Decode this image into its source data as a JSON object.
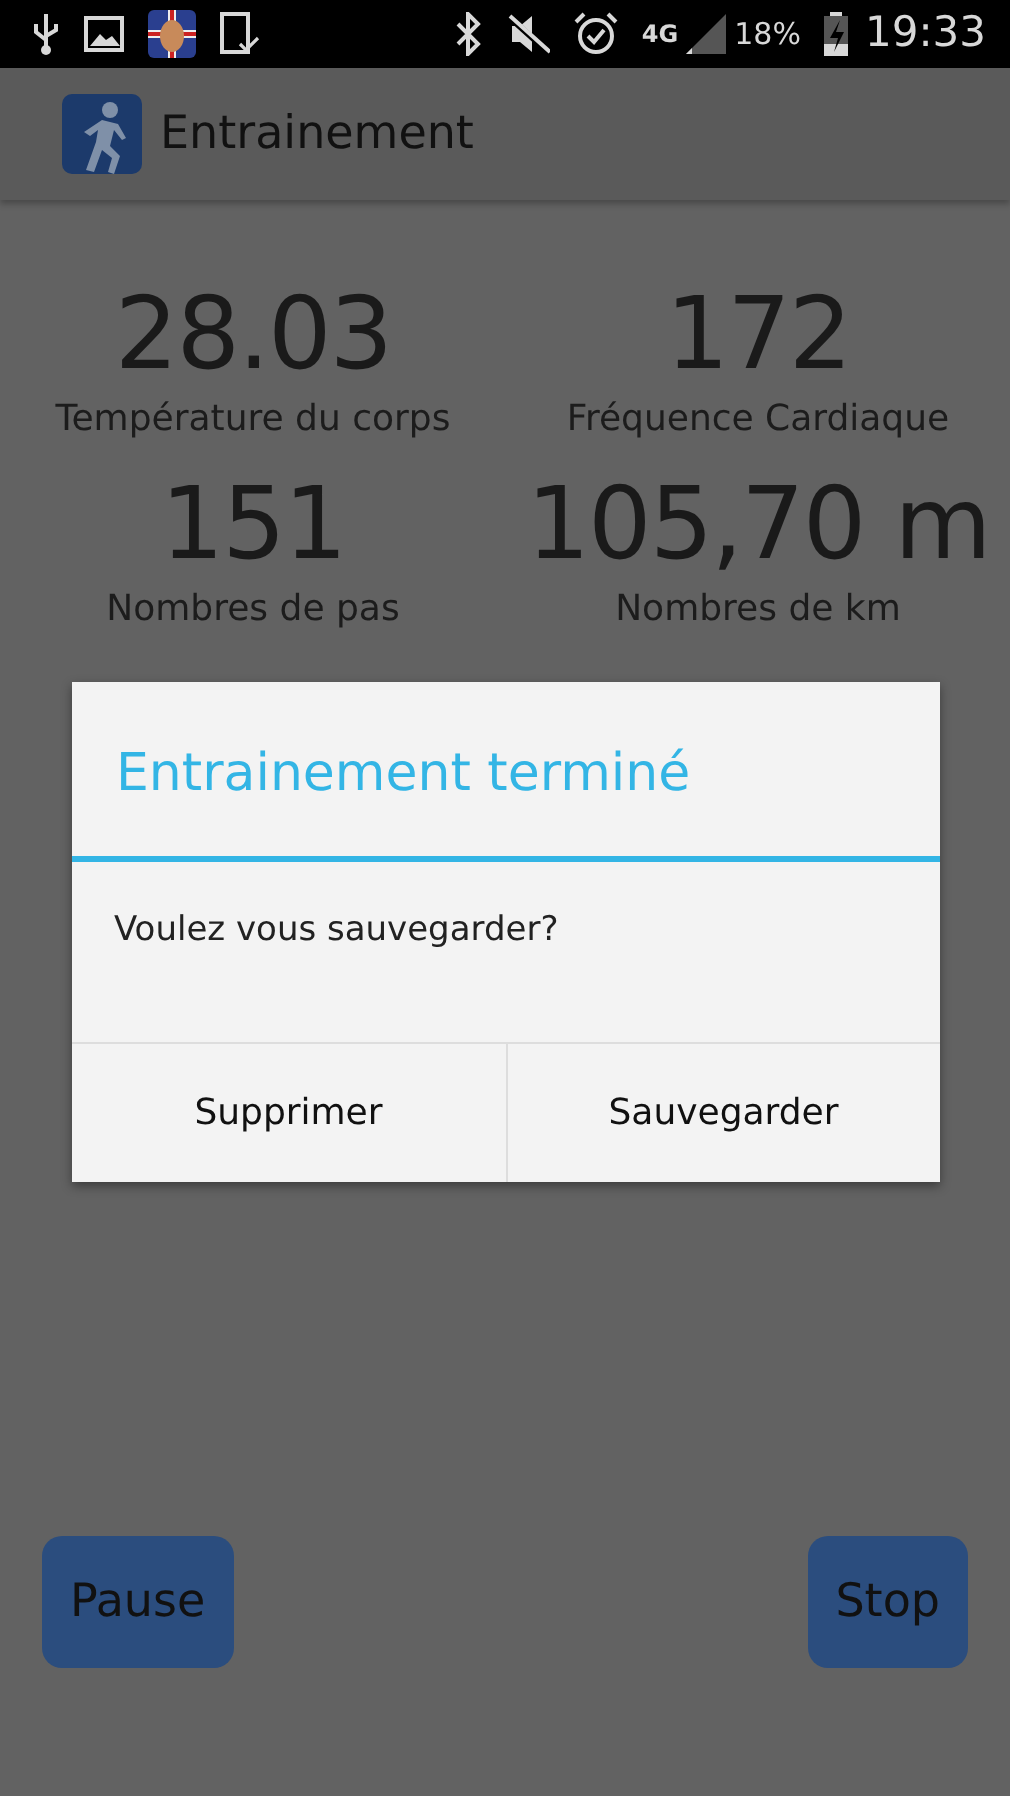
{
  "status_bar": {
    "network": "4G",
    "battery": "18%",
    "time": "19:33"
  },
  "app_bar": {
    "title": "Entrainement"
  },
  "stats": [
    {
      "value": "28.03",
      "label": "Température du corps"
    },
    {
      "value": "172",
      "label": "Fréquence Cardiaque"
    },
    {
      "value": "151",
      "label": "Nombres de pas"
    },
    {
      "value": "105,70 m",
      "label": "Nombres de km"
    }
  ],
  "dialog": {
    "title": "Entrainement terminé",
    "message": "Voulez vous sauvegarder?",
    "buttons": [
      "Supprimer",
      "Sauvegarder"
    ]
  },
  "controls": [
    "Pause",
    "Stop"
  ]
}
